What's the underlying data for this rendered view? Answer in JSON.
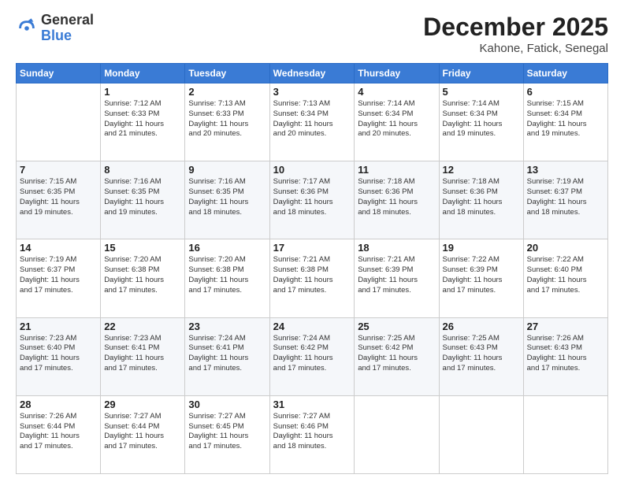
{
  "logo": {
    "general": "General",
    "blue": "Blue"
  },
  "header": {
    "month": "December 2025",
    "location": "Kahone, Fatick, Senegal"
  },
  "days_of_week": [
    "Sunday",
    "Monday",
    "Tuesday",
    "Wednesday",
    "Thursday",
    "Friday",
    "Saturday"
  ],
  "weeks": [
    [
      {
        "day": "",
        "info": ""
      },
      {
        "day": "1",
        "info": "Sunrise: 7:12 AM\nSunset: 6:33 PM\nDaylight: 11 hours\nand 21 minutes."
      },
      {
        "day": "2",
        "info": "Sunrise: 7:13 AM\nSunset: 6:33 PM\nDaylight: 11 hours\nand 20 minutes."
      },
      {
        "day": "3",
        "info": "Sunrise: 7:13 AM\nSunset: 6:34 PM\nDaylight: 11 hours\nand 20 minutes."
      },
      {
        "day": "4",
        "info": "Sunrise: 7:14 AM\nSunset: 6:34 PM\nDaylight: 11 hours\nand 20 minutes."
      },
      {
        "day": "5",
        "info": "Sunrise: 7:14 AM\nSunset: 6:34 PM\nDaylight: 11 hours\nand 19 minutes."
      },
      {
        "day": "6",
        "info": "Sunrise: 7:15 AM\nSunset: 6:34 PM\nDaylight: 11 hours\nand 19 minutes."
      }
    ],
    [
      {
        "day": "7",
        "info": "Sunrise: 7:15 AM\nSunset: 6:35 PM\nDaylight: 11 hours\nand 19 minutes."
      },
      {
        "day": "8",
        "info": "Sunrise: 7:16 AM\nSunset: 6:35 PM\nDaylight: 11 hours\nand 19 minutes."
      },
      {
        "day": "9",
        "info": "Sunrise: 7:16 AM\nSunset: 6:35 PM\nDaylight: 11 hours\nand 18 minutes."
      },
      {
        "day": "10",
        "info": "Sunrise: 7:17 AM\nSunset: 6:36 PM\nDaylight: 11 hours\nand 18 minutes."
      },
      {
        "day": "11",
        "info": "Sunrise: 7:18 AM\nSunset: 6:36 PM\nDaylight: 11 hours\nand 18 minutes."
      },
      {
        "day": "12",
        "info": "Sunrise: 7:18 AM\nSunset: 6:36 PM\nDaylight: 11 hours\nand 18 minutes."
      },
      {
        "day": "13",
        "info": "Sunrise: 7:19 AM\nSunset: 6:37 PM\nDaylight: 11 hours\nand 18 minutes."
      }
    ],
    [
      {
        "day": "14",
        "info": "Sunrise: 7:19 AM\nSunset: 6:37 PM\nDaylight: 11 hours\nand 17 minutes."
      },
      {
        "day": "15",
        "info": "Sunrise: 7:20 AM\nSunset: 6:38 PM\nDaylight: 11 hours\nand 17 minutes."
      },
      {
        "day": "16",
        "info": "Sunrise: 7:20 AM\nSunset: 6:38 PM\nDaylight: 11 hours\nand 17 minutes."
      },
      {
        "day": "17",
        "info": "Sunrise: 7:21 AM\nSunset: 6:38 PM\nDaylight: 11 hours\nand 17 minutes."
      },
      {
        "day": "18",
        "info": "Sunrise: 7:21 AM\nSunset: 6:39 PM\nDaylight: 11 hours\nand 17 minutes."
      },
      {
        "day": "19",
        "info": "Sunrise: 7:22 AM\nSunset: 6:39 PM\nDaylight: 11 hours\nand 17 minutes."
      },
      {
        "day": "20",
        "info": "Sunrise: 7:22 AM\nSunset: 6:40 PM\nDaylight: 11 hours\nand 17 minutes."
      }
    ],
    [
      {
        "day": "21",
        "info": "Sunrise: 7:23 AM\nSunset: 6:40 PM\nDaylight: 11 hours\nand 17 minutes."
      },
      {
        "day": "22",
        "info": "Sunrise: 7:23 AM\nSunset: 6:41 PM\nDaylight: 11 hours\nand 17 minutes."
      },
      {
        "day": "23",
        "info": "Sunrise: 7:24 AM\nSunset: 6:41 PM\nDaylight: 11 hours\nand 17 minutes."
      },
      {
        "day": "24",
        "info": "Sunrise: 7:24 AM\nSunset: 6:42 PM\nDaylight: 11 hours\nand 17 minutes."
      },
      {
        "day": "25",
        "info": "Sunrise: 7:25 AM\nSunset: 6:42 PM\nDaylight: 11 hours\nand 17 minutes."
      },
      {
        "day": "26",
        "info": "Sunrise: 7:25 AM\nSunset: 6:43 PM\nDaylight: 11 hours\nand 17 minutes."
      },
      {
        "day": "27",
        "info": "Sunrise: 7:26 AM\nSunset: 6:43 PM\nDaylight: 11 hours\nand 17 minutes."
      }
    ],
    [
      {
        "day": "28",
        "info": "Sunrise: 7:26 AM\nSunset: 6:44 PM\nDaylight: 11 hours\nand 17 minutes."
      },
      {
        "day": "29",
        "info": "Sunrise: 7:27 AM\nSunset: 6:44 PM\nDaylight: 11 hours\nand 17 minutes."
      },
      {
        "day": "30",
        "info": "Sunrise: 7:27 AM\nSunset: 6:45 PM\nDaylight: 11 hours\nand 17 minutes."
      },
      {
        "day": "31",
        "info": "Sunrise: 7:27 AM\nSunset: 6:46 PM\nDaylight: 11 hours\nand 18 minutes."
      },
      {
        "day": "",
        "info": ""
      },
      {
        "day": "",
        "info": ""
      },
      {
        "day": "",
        "info": ""
      }
    ]
  ]
}
